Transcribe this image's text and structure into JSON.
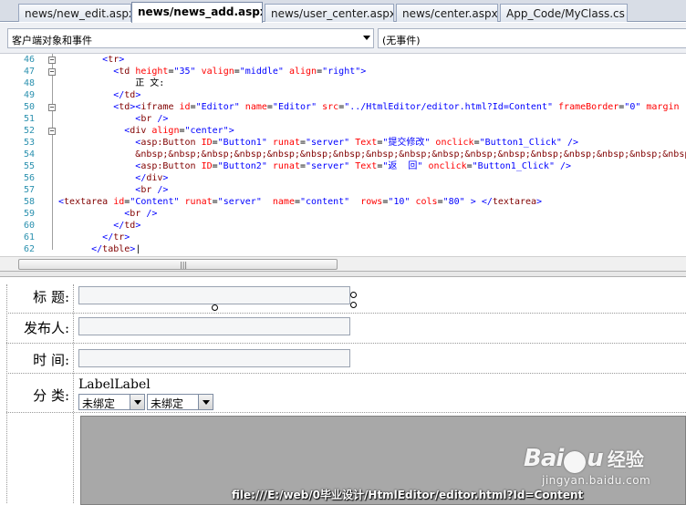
{
  "tabs": [
    {
      "label": "news/new_edit.aspx",
      "active": false
    },
    {
      "label": "news/news_add.aspx*",
      "active": true
    },
    {
      "label": "news/user_center.aspx",
      "active": false
    },
    {
      "label": "news/center.aspx",
      "active": false
    },
    {
      "label": "App_Code/MyClass.cs",
      "active": false
    }
  ],
  "toolbar": {
    "object_select": "客户端对象和事件",
    "event_select": "(无事件)"
  },
  "code": {
    "lines": [
      {
        "num": "46",
        "fold": "−",
        "indent": "        ",
        "html": "<span class='br'>&lt;</span><span class='tag'>tr</span><span class='br'>&gt;</span>"
      },
      {
        "num": "47",
        "fold": "−",
        "indent": "          ",
        "html": "<span class='br'>&lt;</span><span class='tag'>td</span> <span class='attr'>height</span>=<span class='val'>\"35\"</span> <span class='attr'>valign</span>=<span class='val'>\"middle\"</span> <span class='attr'>align</span>=<span class='val'>\"right\"</span><span class='br'>&gt;</span>"
      },
      {
        "num": "48",
        "fold": "",
        "indent": "              ",
        "html": "正 文:"
      },
      {
        "num": "49",
        "fold": "",
        "indent": "          ",
        "html": "<span class='br'>&lt;/</span><span class='tag'>td</span><span class='br'>&gt;</span>"
      },
      {
        "num": "50",
        "fold": "−",
        "indent": "          ",
        "html": "<span class='br'>&lt;</span><span class='tag'>td</span><span class='br'>&gt;</span><span class='br'>&lt;</span><span class='tag'>iframe</span> <span class='attr'>id</span>=<span class='val'>\"Editor\"</span> <span class='attr'>name</span>=<span class='val'>\"Editor\"</span> <span class='attr'>src</span>=<span class='val'>\"../HtmlEditor/editor.html?Id=Content\"</span> <span class='attr'>frameBorder</span>=<span class='val'>\"0\"</span> <span class='attr'>margin</span>"
      },
      {
        "num": "51",
        "fold": "",
        "indent": "              ",
        "html": "<span class='br'>&lt;</span><span class='tag'>br</span> <span class='br'>/&gt;</span>"
      },
      {
        "num": "52",
        "fold": "−",
        "indent": "            ",
        "html": "<span class='br'>&lt;</span><span class='tag'>div</span> <span class='attr'>align</span>=<span class='val'>\"center\"</span><span class='br'>&gt;</span>"
      },
      {
        "num": "53",
        "fold": "",
        "indent": "              ",
        "html": "<span class='br'>&lt;</span><span class='tag'>asp:Button</span> <span class='attr'>ID</span>=<span class='val'>\"Button1\"</span> <span class='attr'>runat</span>=<span class='val'>\"server\"</span> <span class='attr'>Text</span>=<span class='val'>\"提交修改\"</span> <span class='attr'>onclick</span>=<span class='val'>\"Button1_Click\"</span> <span class='br'>/&gt;</span>"
      },
      {
        "num": "54",
        "fold": "",
        "indent": "              ",
        "html": "<span class='tag'>&amp;nbsp;&amp;nbsp;&amp;nbsp;&amp;nbsp;&amp;nbsp;&amp;nbsp;&amp;nbsp;&amp;nbsp;&amp;nbsp;&amp;nbsp;&amp;nbsp;&amp;nbsp;&amp;nbsp;&amp;nbsp;&amp;nbsp;&amp;nbsp;&amp;nbsp;</span>"
      },
      {
        "num": "55",
        "fold": "",
        "indent": "              ",
        "html": "<span class='br'>&lt;</span><span class='tag'>asp:Button</span> <span class='attr'>ID</span>=<span class='val'>\"Button2\"</span> <span class='attr'>runat</span>=<span class='val'>\"server\"</span> <span class='attr'>Text</span>=<span class='val'>\"返  回\"</span> <span class='attr'>onclick</span>=<span class='val'>\"Button1_Click\"</span> <span class='br'>/&gt;</span>"
      },
      {
        "num": "56",
        "fold": "",
        "indent": "              ",
        "html": "<span class='br'>&lt;/</span><span class='tag'>div</span><span class='br'>&gt;</span>"
      },
      {
        "num": "57",
        "fold": "",
        "indent": "              ",
        "html": "<span class='br'>&lt;</span><span class='tag'>br</span> <span class='br'>/&gt;</span>"
      },
      {
        "num": "58",
        "fold": "",
        "indent": "",
        "html": "<span class='br'>&lt;</span><span class='tag'>textarea</span> <span class='attr'>id</span>=<span class='val'>\"Content\"</span> <span class='attr'>runat</span>=<span class='val'>\"server\"</span>  <span class='attr'>name</span>=<span class='val'>\"content\"</span>  <span class='attr'>rows</span>=<span class='val'>\"10\"</span> <span class='attr'>cols</span>=<span class='val'>\"80\"</span> <span class='br'>&gt;</span> <span class='br'>&lt;/</span><span class='tag'>textarea</span><span class='br'>&gt;</span>"
      },
      {
        "num": "59",
        "fold": "",
        "indent": "            ",
        "html": "<span class='br'>&lt;</span><span class='tag'>br</span> <span class='br'>/&gt;</span>"
      },
      {
        "num": "60",
        "fold": "",
        "indent": "          ",
        "html": "<span class='br'>&lt;/</span><span class='tag'>td</span><span class='br'>&gt;</span>"
      },
      {
        "num": "61",
        "fold": "",
        "indent": "        ",
        "html": "<span class='br'>&lt;/</span><span class='tag'>tr</span><span class='br'>&gt;</span>"
      },
      {
        "num": "62",
        "fold": "",
        "indent": "      ",
        "html": "<span class='br'>&lt;/</span><span class='tag'>table</span><span class='br'>&gt;</span>|"
      }
    ]
  },
  "scroll": {
    "grip": "|||"
  },
  "design": {
    "labels": {
      "title": "标 题:",
      "publisher": "发布人:",
      "time": "时 间:",
      "category": "分 类:"
    },
    "label_text": "LabelLabel",
    "select1": "未绑定",
    "select2": "未绑定"
  },
  "status": {
    "path": "file:///E:/web/0毕业设计/HtmlEditor/editor.html?Id=Content"
  },
  "watermark": {
    "brand_left": "Bai",
    "brand_right": "u",
    "brand_cn": "经验",
    "url": "jingyan.baidu.com"
  }
}
